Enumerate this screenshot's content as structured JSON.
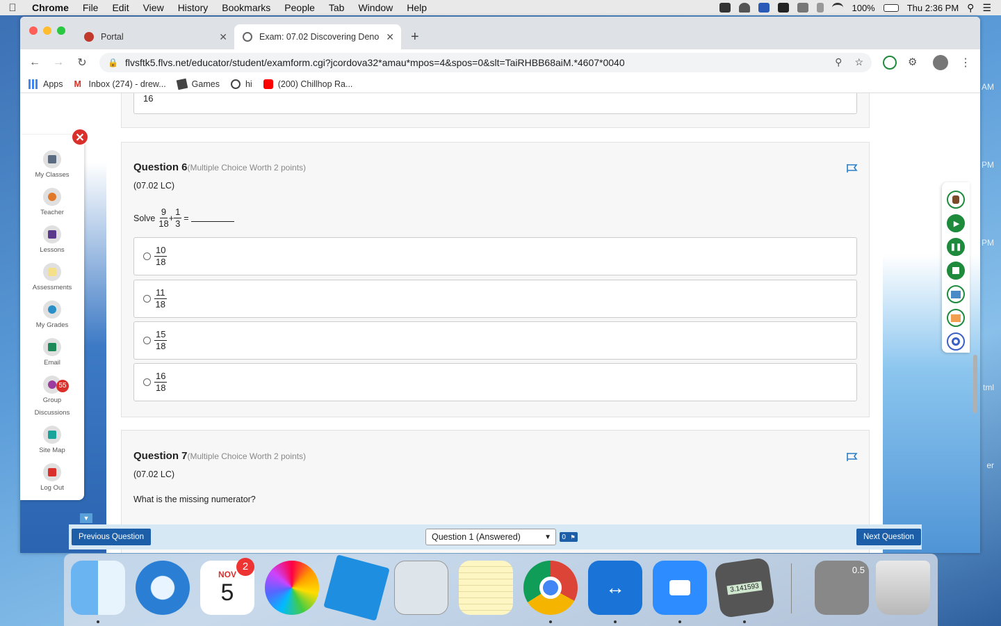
{
  "menubar": {
    "app": "Chrome",
    "items": [
      "File",
      "Edit",
      "View",
      "History",
      "Bookmarks",
      "People",
      "Tab",
      "Window",
      "Help"
    ],
    "battery": "100%",
    "clock": "Thu 2:36 PM"
  },
  "browser": {
    "tabs": [
      {
        "title": "Portal"
      },
      {
        "title": "Exam: 07.02 Discovering Deno"
      }
    ],
    "url": "flvsftk5.flvs.net/educator/student/examform.cgi?jcordova32*amau*mpos=4&spos=0&slt=TaiRHBB68aiM.*4607*0040",
    "bookmarks": [
      "Apps",
      "Inbox (274) - drew...",
      "Games",
      "hi",
      "(200) Chillhop Ra..."
    ]
  },
  "desktop_labels": [
    "AM",
    "PM",
    "PM",
    "tml",
    "er"
  ],
  "sidenav": {
    "items": [
      {
        "label": "My Classes",
        "icon": "book-stack-icon"
      },
      {
        "label": "Teacher",
        "icon": "pushpin-icon"
      },
      {
        "label": "Lessons",
        "icon": "notebook-icon"
      },
      {
        "label": "Assessments",
        "icon": "note-icon"
      },
      {
        "label": "My Grades",
        "icon": "grades-icon"
      },
      {
        "label": "Email",
        "icon": "envelope-icon"
      },
      {
        "label": "Group",
        "label2": "Discussions",
        "icon": "chat-bubbles-icon"
      },
      {
        "label": "Site Map",
        "icon": "sitemap-icon"
      },
      {
        "label": "Log Out",
        "icon": "logout-icon"
      }
    ],
    "badge": "55"
  },
  "prev_question": {
    "last_fraction_den": "16"
  },
  "question6": {
    "title": "Question 6",
    "points": "(Multiple Choice Worth 2 points)",
    "code": "(07.02 LC)",
    "prompt": "Solve",
    "expr": {
      "a_num": "9",
      "a_den": "18",
      "op": "+",
      "b_num": "1",
      "b_den": "3",
      "eq": "="
    },
    "choices": [
      {
        "num": "10",
        "den": "18"
      },
      {
        "num": "11",
        "den": "18"
      },
      {
        "num": "15",
        "den": "18"
      },
      {
        "num": "16",
        "den": "18"
      }
    ]
  },
  "question7": {
    "title": "Question 7",
    "points": "(Multiple Choice Worth 2 points)",
    "code": "(07.02 LC)",
    "prompt": "What is the missing numerator?"
  },
  "bottombar": {
    "prev_label": "Previous Question",
    "select_value": "Question 1 (Answered)",
    "flag_count": "0",
    "next_label": "Next Question"
  },
  "dock": {
    "calendar_month": "NOV",
    "calendar_day": "5",
    "calendar_badge": "2",
    "calc_display": "3.141593",
    "calc2_display": "0.5"
  }
}
